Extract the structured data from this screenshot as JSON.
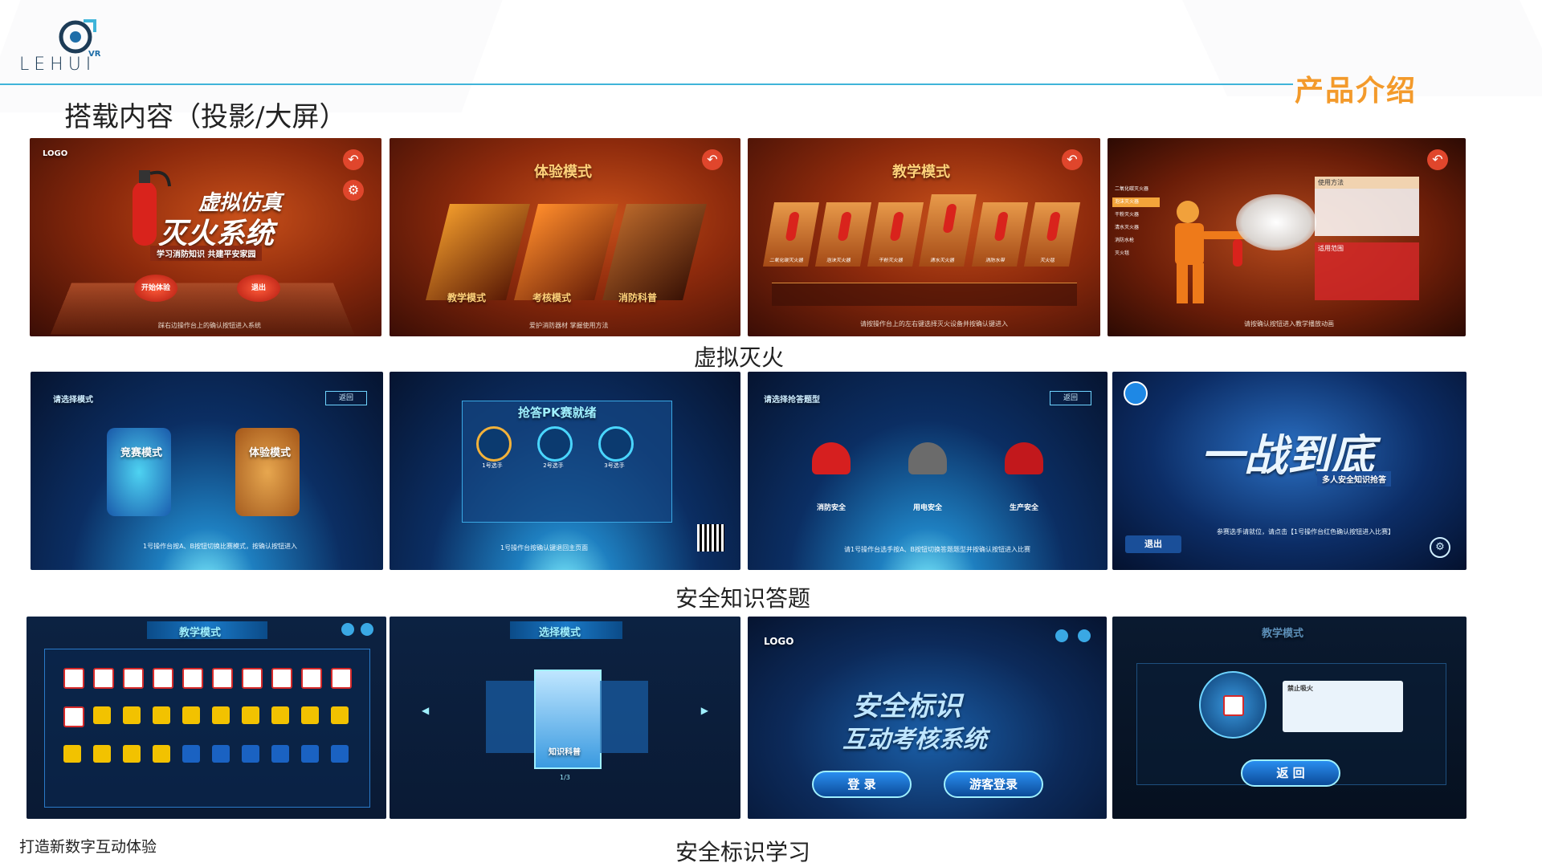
{
  "header": {
    "logo_text": "LEHUI",
    "logo_vr": "VR",
    "brand_title": "产品介绍",
    "section_title": "搭载内容（投影/大屏）"
  },
  "captions": {
    "row1": "虚拟灭火",
    "row2": "安全知识答题",
    "row3": "安全标识学习"
  },
  "footer": "打造新数字互动体验",
  "row1": {
    "t1": {
      "logo": "LOGO",
      "title_line1": "虚拟仿真",
      "title_line2": "灭火系统",
      "subtitle": "学习消防知识 共建平安家园",
      "btn_left": "开始体验",
      "btn_right": "退出",
      "hint": "踩右边操作台上的确认按钮进入系统"
    },
    "t2": {
      "title": "体验模式",
      "labels": [
        "教学模式",
        "考核模式",
        "消防科普"
      ],
      "hint": "爱护消防器材 掌握使用方法"
    },
    "t3": {
      "title": "教学模式",
      "labels": [
        "二氧化碳灭火器",
        "泡沫灭火器",
        "干粉灭火器",
        "清水灭火器",
        "消防水带",
        "灭火毯"
      ],
      "hint": "请按操作台上的左右键选择灭火设备并按确认键进入"
    },
    "t4": {
      "menu": [
        "二氧化碳灭火器",
        "泡沫灭火器",
        "干粉灭火器",
        "清水灭火器",
        "消防水枪",
        "灭火毯"
      ],
      "panel1": "使用方法",
      "panel2": "适用范围",
      "hint": "请按确认按钮进入教学播放动画"
    }
  },
  "row2": {
    "t1": {
      "header": "请选择模式",
      "back": "返回",
      "mode_left": "竞赛模式",
      "mode_right": "体验模式",
      "hint": "1号操作台按A、B按钮切换比赛模式，按确认按钮进入"
    },
    "t2": {
      "title": "抢答PK赛就绪",
      "players": [
        "1号选手",
        "2号选手",
        "3号选手"
      ],
      "hint": "1号操作台按确认键退回主页面"
    },
    "t3": {
      "header": "请选择抢答题型",
      "back": "返回",
      "options": [
        "消防安全",
        "用电安全",
        "生产安全"
      ],
      "hint": "请1号操作台选手按A、B按钮切换答题题型并按确认按钮进入比赛"
    },
    "t4": {
      "title": "一战到底",
      "subtitle": "多人安全知识抢答",
      "exit": "退出",
      "hint": "参赛选手请就位，请点击【1号操作台红色确认按钮进入比赛】"
    }
  },
  "row3": {
    "t1": {
      "title": "教学模式"
    },
    "t2": {
      "title": "选择模式",
      "card": "知识科普",
      "page": "1/3"
    },
    "t3": {
      "logo": "LOGO",
      "title_line1": "安全标识",
      "title_line2": "互动考核系统",
      "btn_login": "登 录",
      "btn_guest": "游客登录"
    },
    "t4": {
      "title": "教学模式",
      "popup_title": "禁止吸火",
      "back": "返 回"
    }
  }
}
